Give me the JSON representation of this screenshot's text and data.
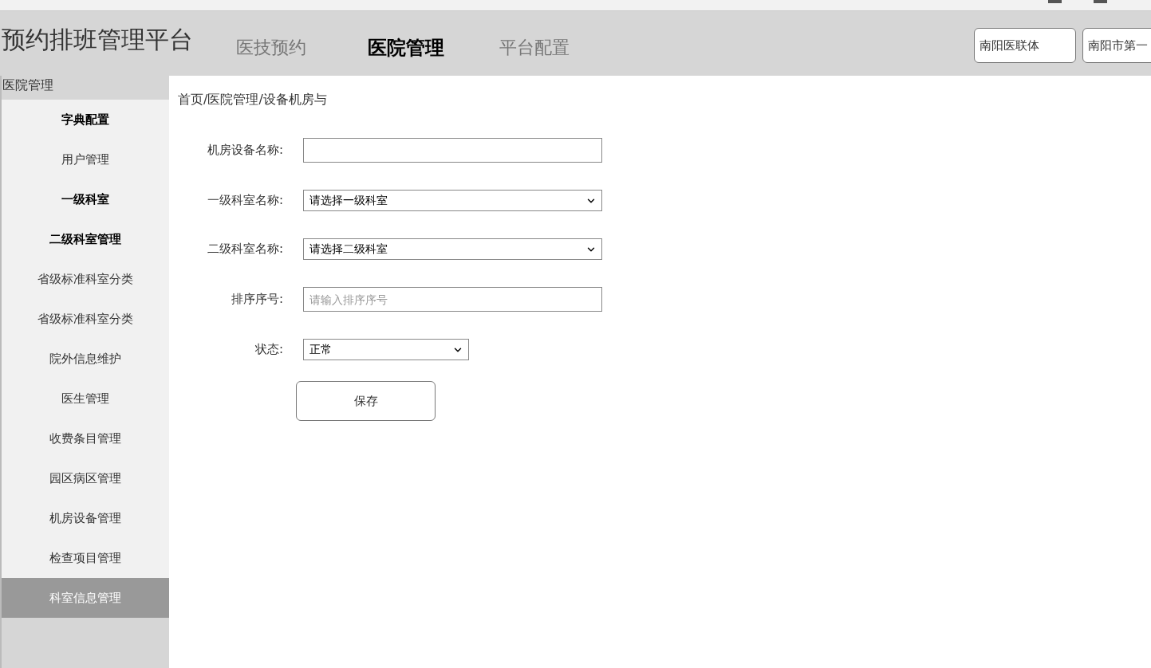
{
  "app_title": "预约排班管理平台",
  "nav_tabs": [
    {
      "label": "医技预约",
      "selected": false
    },
    {
      "label": "医院管理",
      "selected": true
    },
    {
      "label": "平台配置",
      "selected": false
    }
  ],
  "header_chips": [
    "南阳医联体",
    "南阳市第一"
  ],
  "sidebar": {
    "section": "医院管理",
    "items": [
      {
        "label": "字典配置",
        "bold": true,
        "selected": false
      },
      {
        "label": "用户管理",
        "bold": false,
        "selected": false
      },
      {
        "label": "一级科室",
        "bold": true,
        "selected": false
      },
      {
        "label": "二级科室管理",
        "bold": true,
        "selected": false
      },
      {
        "label": "省级标准科室分类",
        "bold": false,
        "selected": false
      },
      {
        "label": "省级标准科室分类",
        "bold": false,
        "selected": false
      },
      {
        "label": "院外信息维护",
        "bold": false,
        "selected": false
      },
      {
        "label": "医生管理",
        "bold": false,
        "selected": false
      },
      {
        "label": "收费条目管理",
        "bold": false,
        "selected": false
      },
      {
        "label": "园区病区管理",
        "bold": false,
        "selected": false
      },
      {
        "label": "机房设备管理",
        "bold": false,
        "selected": false
      },
      {
        "label": "检查项目管理",
        "bold": false,
        "selected": false
      },
      {
        "label": "科室信息管理",
        "bold": false,
        "selected": true
      }
    ]
  },
  "breadcrumb": "首页/医院管理/设备机房与",
  "form": {
    "fields": [
      {
        "kind": "text",
        "label": "机房设备名称:"
      },
      {
        "kind": "select",
        "label": "一级科室名称:",
        "value": "请选择一级科室"
      },
      {
        "kind": "select",
        "label": "二级科室名称:",
        "value": "请选择二级科室"
      },
      {
        "kind": "text",
        "label": "排序序号:",
        "placeholder": "请输入排序序号"
      },
      {
        "kind": "select_short",
        "label": "状态:",
        "value": "正常"
      }
    ],
    "save_button": "保存"
  }
}
